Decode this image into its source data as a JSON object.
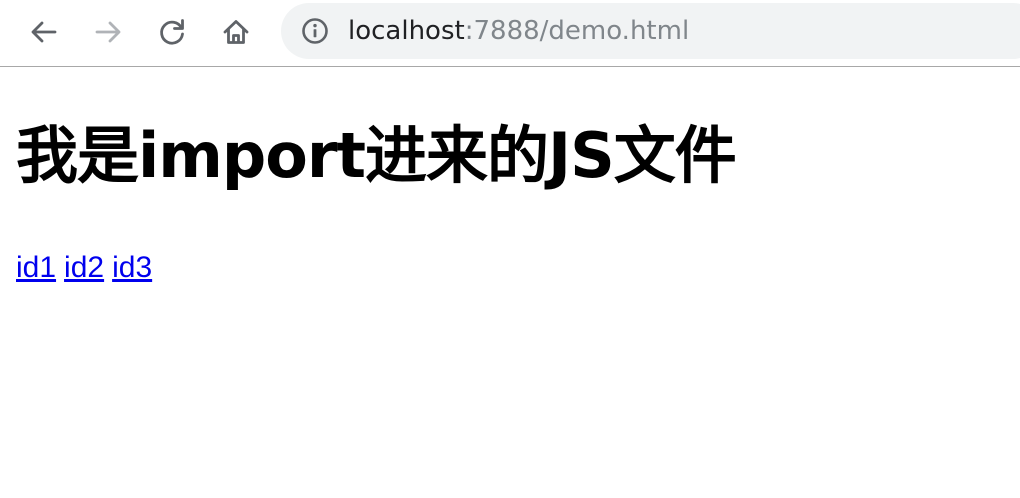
{
  "browser": {
    "url_host": "localhost",
    "url_rest": ":7888/demo.html",
    "icons": {
      "back": "arrow-left-icon",
      "forward": "arrow-right-icon",
      "reload": "reload-icon",
      "home": "home-icon",
      "site_info": "info-icon"
    },
    "forward_enabled": false
  },
  "page": {
    "heading": "我是import进来的JS文件",
    "links": [
      {
        "text": "id1"
      },
      {
        "text": "id2"
      },
      {
        "text": "id3"
      }
    ]
  },
  "colors": {
    "link": "#0000ee",
    "omnibox_bg": "#f1f3f4",
    "toolbar_border": "#a8a8a8",
    "icon": "#5f6368",
    "icon_disabled": "#b0b3b7"
  }
}
